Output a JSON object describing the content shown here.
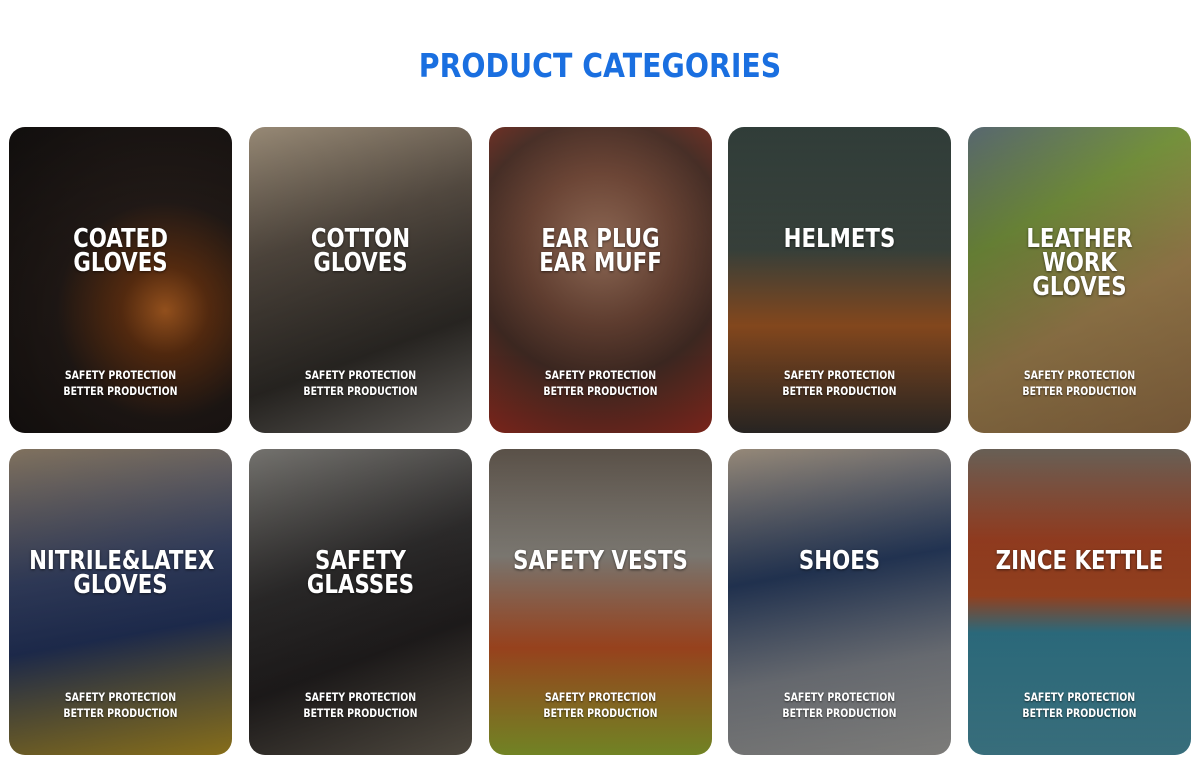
{
  "page_title": "PRODUCT CATEGORIES",
  "cards": [
    {
      "title": "COATED GLOVES",
      "sub1": "SAFETY PROTECTION",
      "sub2": "BETTER PRODUCTION"
    },
    {
      "title": "COTTON GLOVES",
      "sub1": "SAFETY PROTECTION",
      "sub2": "BETTER PRODUCTION"
    },
    {
      "title": "EAR PLUG\nEAR MUFF",
      "sub1": "SAFETY PROTECTION",
      "sub2": "BETTER PRODUCTION"
    },
    {
      "title": "HELMETS",
      "sub1": "SAFETY PROTECTION",
      "sub2": "BETTER PRODUCTION"
    },
    {
      "title": "LEATHER WORK\nGLOVES",
      "sub1": "SAFETY PROTECTION",
      "sub2": "BETTER PRODUCTION"
    },
    {
      "title": "NITRILE&LATEX\nGLOVES",
      "sub1": "SAFETY PROTECTION",
      "sub2": "BETTER PRODUCTION"
    },
    {
      "title": "SAFETY GLASSES",
      "sub1": "SAFETY PROTECTION",
      "sub2": "BETTER PRODUCTION"
    },
    {
      "title": "SAFETY VESTS",
      "sub1": "SAFETY PROTECTION",
      "sub2": "BETTER PRODUCTION"
    },
    {
      "title": "SHOES",
      "sub1": "SAFETY PROTECTION",
      "sub2": "BETTER PRODUCTION"
    },
    {
      "title": "ZINCE KETTLE",
      "sub1": "SAFETY PROTECTION",
      "sub2": "BETTER PRODUCTION"
    }
  ],
  "colors": {
    "title": "#1a6fe0",
    "card_text": "#ffffff",
    "background": "#ffffff"
  }
}
